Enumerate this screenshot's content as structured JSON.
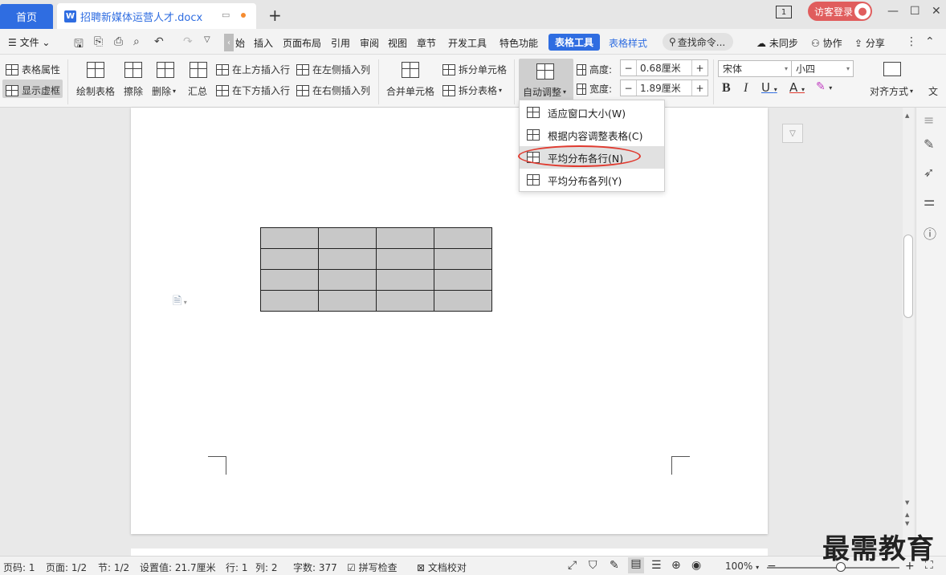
{
  "tabs": {
    "home": "首页",
    "doc": "招聘新媒体运营人才.docx"
  },
  "topright": {
    "page_indicator": "1",
    "visitor_login": "访客登录"
  },
  "menu": {
    "file": "文件",
    "items": [
      "始",
      "插入",
      "页面布局",
      "引用",
      "审阅",
      "视图",
      "章节",
      "开发工具",
      "特色功能"
    ],
    "table_tool": "表格工具",
    "table_style": "表格样式",
    "search": "查找命令...",
    "sync": "未同步",
    "collab": "协作",
    "share": "分享"
  },
  "ribbon": {
    "table_props": "表格属性",
    "show_grid": "显示虚框",
    "draw_table": "绘制表格",
    "erase": "擦除",
    "delete": "删除",
    "summary": "汇总",
    "insert_above": "在上方插入行",
    "insert_below": "在下方插入行",
    "insert_left": "在左侧插入列",
    "insert_right": "在右侧插入列",
    "merge_cells": "合并单元格",
    "split_cells": "拆分单元格",
    "split_table": "拆分表格",
    "auto_adjust": "自动调整",
    "height_label": "高度:",
    "height_value": "0.68厘米",
    "width_label": "宽度:",
    "width_value": "1.89厘米",
    "font_name": "宋体",
    "font_size": "小四",
    "align": "对齐方式",
    "text_dir": "文"
  },
  "dropdown": {
    "items": [
      "适应窗口大小(W)",
      "根据内容调整表格(C)",
      "平均分布各行(N)",
      "平均分布各列(Y)"
    ]
  },
  "table": {
    "rows": 4,
    "cols": 4
  },
  "status": {
    "page_no": "页码: 1",
    "pages": "页面: 1/2",
    "section": "节: 1/2",
    "setting": "设置值: 21.7厘米",
    "row": "行: 1",
    "col": "列: 2",
    "words": "字数: 377",
    "spell": "拼写检查",
    "proof": "文档校对",
    "zoom": "100%"
  },
  "watermark": "最需教育",
  "colors": {
    "accent": "#2f6de1",
    "highlight": "#e03a2f",
    "cell": "#c8c8c8"
  }
}
